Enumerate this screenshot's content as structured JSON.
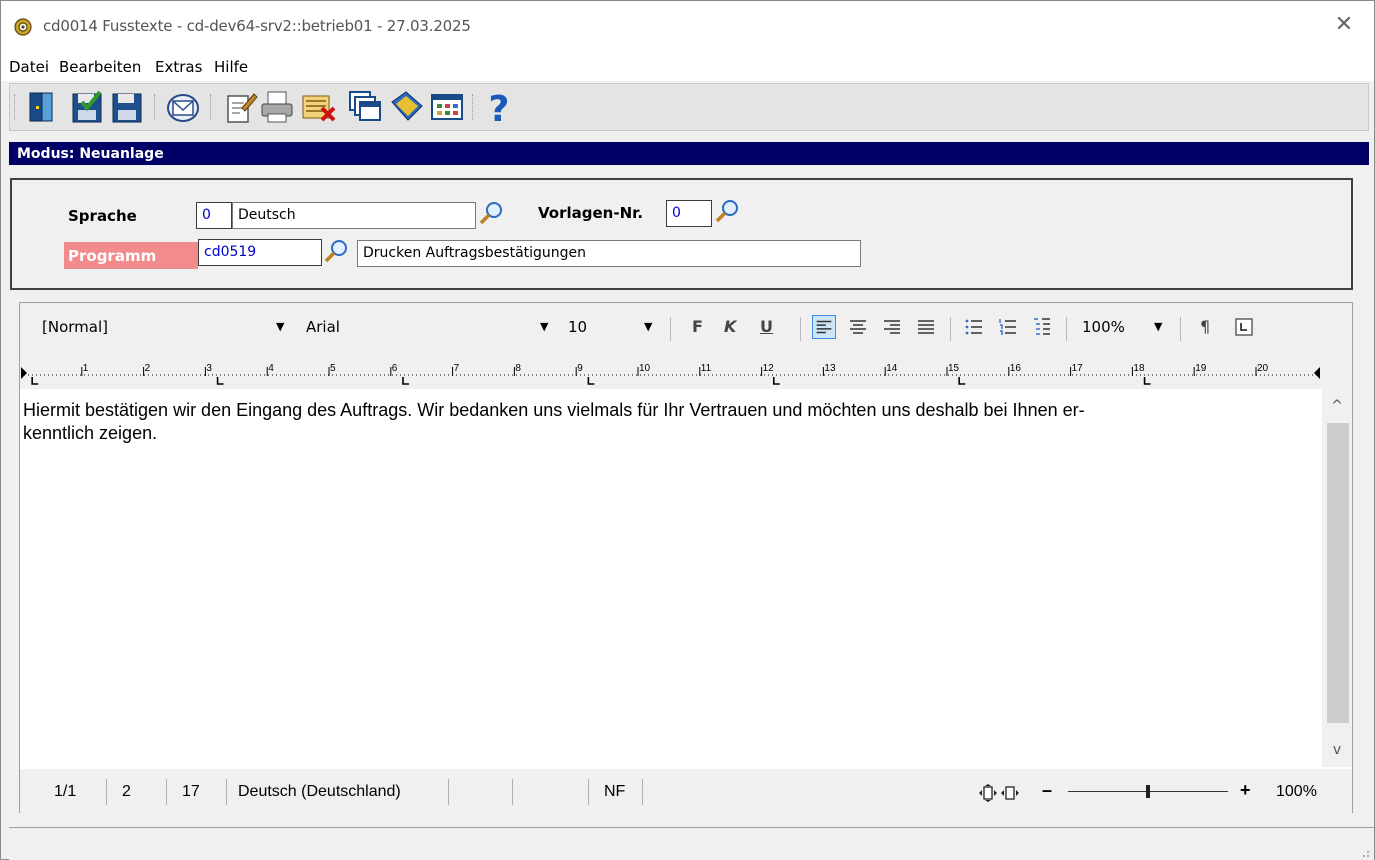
{
  "window": {
    "title": "cd0014 Fusstexte - cd-dev64-srv2::betrieb01 - 27.03.2025",
    "close_glyph": "✕"
  },
  "menu": {
    "items": [
      "Datei",
      "Bearbeiten",
      "Extras",
      "Hilfe"
    ]
  },
  "toolbar": {
    "icons": [
      "exit-icon",
      "save-and-close-icon",
      "save-icon",
      "mail-icon",
      "edit-icon",
      "print-icon",
      "delete-icon",
      "windows-icon",
      "book-icon",
      "grid-icon",
      "help-icon"
    ]
  },
  "modus": {
    "text": "Modus: Neuanlage"
  },
  "form": {
    "sprache_label": "Sprache",
    "sprache_code": "0",
    "sprache_name": "Deutsch",
    "vorlage_label": "Vorlagen-Nr.",
    "vorlage_value": "0",
    "programm_label": "Programm",
    "programm_code": "cd0519",
    "programm_name": "Drucken Auftragsbestätigungen",
    "programm_label_color": "#f28b8b"
  },
  "editor": {
    "style": "[Normal]",
    "font": "Arial",
    "size": "10",
    "bold": "F",
    "italic": "K",
    "underline": "U",
    "zoom_combo": "100%",
    "pilcrow": "¶",
    "ruler_numbers": [
      "1",
      "2",
      "3",
      "4",
      "5",
      "6",
      "7",
      "8",
      "9",
      "10",
      "11",
      "12",
      "13",
      "14",
      "15",
      "16",
      "17",
      "18",
      "19",
      "20"
    ],
    "text_line1": "Hiermit bestätigen wir den Eingang des Auftrags. Wir bedanken uns vielmals für Ihr Vertrauen und möchten uns deshalb bei Ihnen er-",
    "text_line2": "kenntlich zeigen.",
    "scroll_up": "^",
    "scroll_down": "v"
  },
  "status": {
    "page": "1/1",
    "line": "2",
    "column": "17",
    "language": "Deutsch (Deutschland)",
    "mode": "NF",
    "zoom_minus": "–",
    "zoom_plus": "+",
    "zoom": "100%",
    "zoom_level_percent": 100
  }
}
